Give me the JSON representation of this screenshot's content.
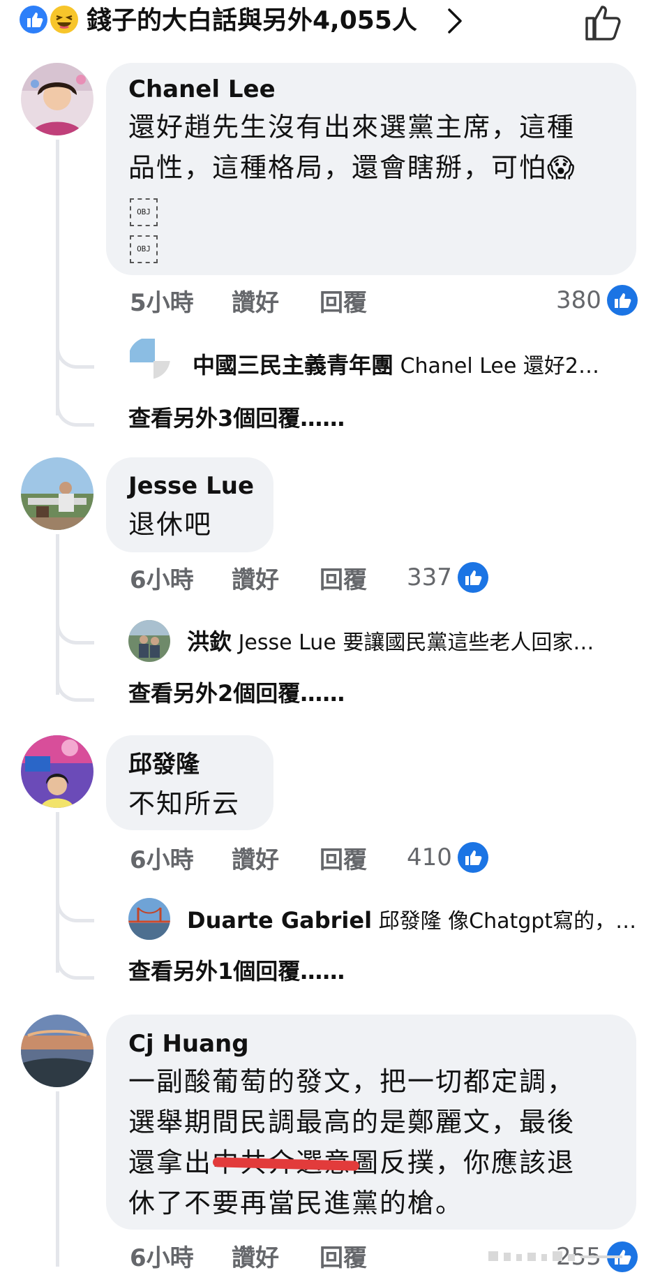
{
  "header": {
    "reactions_text": "錢子的大白話與另外4,055人"
  },
  "comments": [
    {
      "author": "Chanel Lee",
      "lines": [
        "還好趙先生沒有出來選黨主席，這種",
        "品性，這種格局，還會瞎掰，可怕😱"
      ],
      "attachments": [
        "OBJ",
        "OBJ"
      ],
      "time": "5小時",
      "like_label": "讚好",
      "reply_label": "回覆",
      "reactions": "380",
      "reply_preview": {
        "author": "中國三民主義青年團",
        "text": "Chanel Lee 還好2…"
      },
      "more_replies": "查看另外3個回覆……"
    },
    {
      "author": "Jesse Lue",
      "lines": [
        "退休吧"
      ],
      "time": "6小時",
      "like_label": "讚好",
      "reply_label": "回覆",
      "reactions": "337",
      "reply_preview": {
        "author": "洪欽",
        "text": "Jesse Lue 要讓國民黨這些老人回家…"
      },
      "more_replies": "查看另外2個回覆……"
    },
    {
      "author": "邱發隆",
      "lines": [
        "不知所云"
      ],
      "time": "6小時",
      "like_label": "讚好",
      "reply_label": "回覆",
      "reactions": "410",
      "reply_preview": {
        "author": "Duarte Gabriel",
        "text": "邱發隆 像Chatgpt寫的，…"
      },
      "more_replies": "查看另外1個回覆……"
    },
    {
      "author": "Cj Huang",
      "lines": [
        "一副酸葡萄的發文，把一切都定調，",
        "選舉期間民調最高的是鄭麗文，最後",
        "還拿出中共介選意圖反撲，你應該退",
        "休了不要再當民進黨的槍。"
      ],
      "time": "6小時",
      "like_label": "讚好",
      "reply_label": "回覆",
      "reactions": "255"
    }
  ],
  "colors": {
    "like_blue": "#1b74e4",
    "bubble_bg": "#f0f2f5",
    "meta_gray": "#65676b",
    "thread_line": "#e4e6eb",
    "strike_red": "#e23b3b"
  }
}
